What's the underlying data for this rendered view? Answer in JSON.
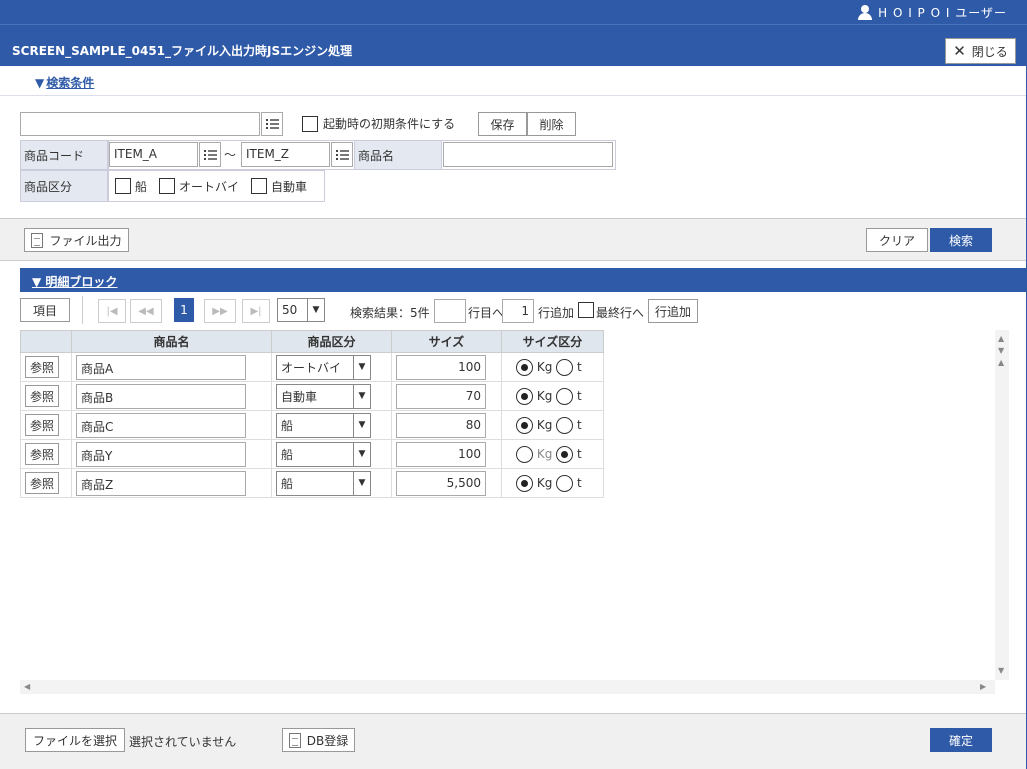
{
  "header": {
    "user_name": "H O I P O I ユーザー",
    "screen_title": "SCREEN_SAMPLE_0451_ファイル入出力時JSエンジン処理",
    "close_label": "閉じる"
  },
  "search_section": {
    "toggle_label": "検索条件",
    "saved_condition_value": "",
    "startup_default_label": "起動時の初期条件にする",
    "save_label": "保存",
    "delete_label": "削除",
    "product_code_label": "商品コード",
    "code_from": "ITEM_A",
    "range_sep": "～",
    "code_to": "ITEM_Z",
    "product_name_label": "商品名",
    "product_name_value": "",
    "category_label": "商品区分",
    "categories": [
      "船",
      "オートバイ",
      "自動車"
    ]
  },
  "toolbar": {
    "file_output_label": "ファイル出力",
    "clear_label": "クリア",
    "search_label": "検索"
  },
  "detail_block": {
    "title": "明細ブロック",
    "items_label": "項目",
    "current_page": "1",
    "page_size": "50",
    "result_text": "検索結果：5件",
    "goto_row_value": "",
    "goto_suffix": "行目へ",
    "add_count": "1",
    "add_rows_label": "行追加",
    "last_row_label": "最終行へ",
    "add_row_button": "行追加",
    "columns": [
      "商品名",
      "商品区分",
      "サイズ",
      "サイズ区分"
    ],
    "ref_label": "参照",
    "unit_kg": "Kg",
    "unit_t": "t",
    "rows": [
      {
        "name": "商品A",
        "category": "オートバイ",
        "size": "100",
        "unit": "Kg"
      },
      {
        "name": "商品B",
        "category": "自動車",
        "size": "70",
        "unit": "Kg"
      },
      {
        "name": "商品C",
        "category": "船",
        "size": "80",
        "unit": "Kg"
      },
      {
        "name": "商品Y",
        "category": "船",
        "size": "100",
        "unit": "t"
      },
      {
        "name": "商品Z",
        "category": "船",
        "size": "5,500",
        "unit": "Kg"
      }
    ]
  },
  "footer": {
    "choose_file_label": "ファイルを選択",
    "no_file_text": "選択されていません",
    "db_register_label": "DB登録",
    "confirm_label": "確定"
  }
}
